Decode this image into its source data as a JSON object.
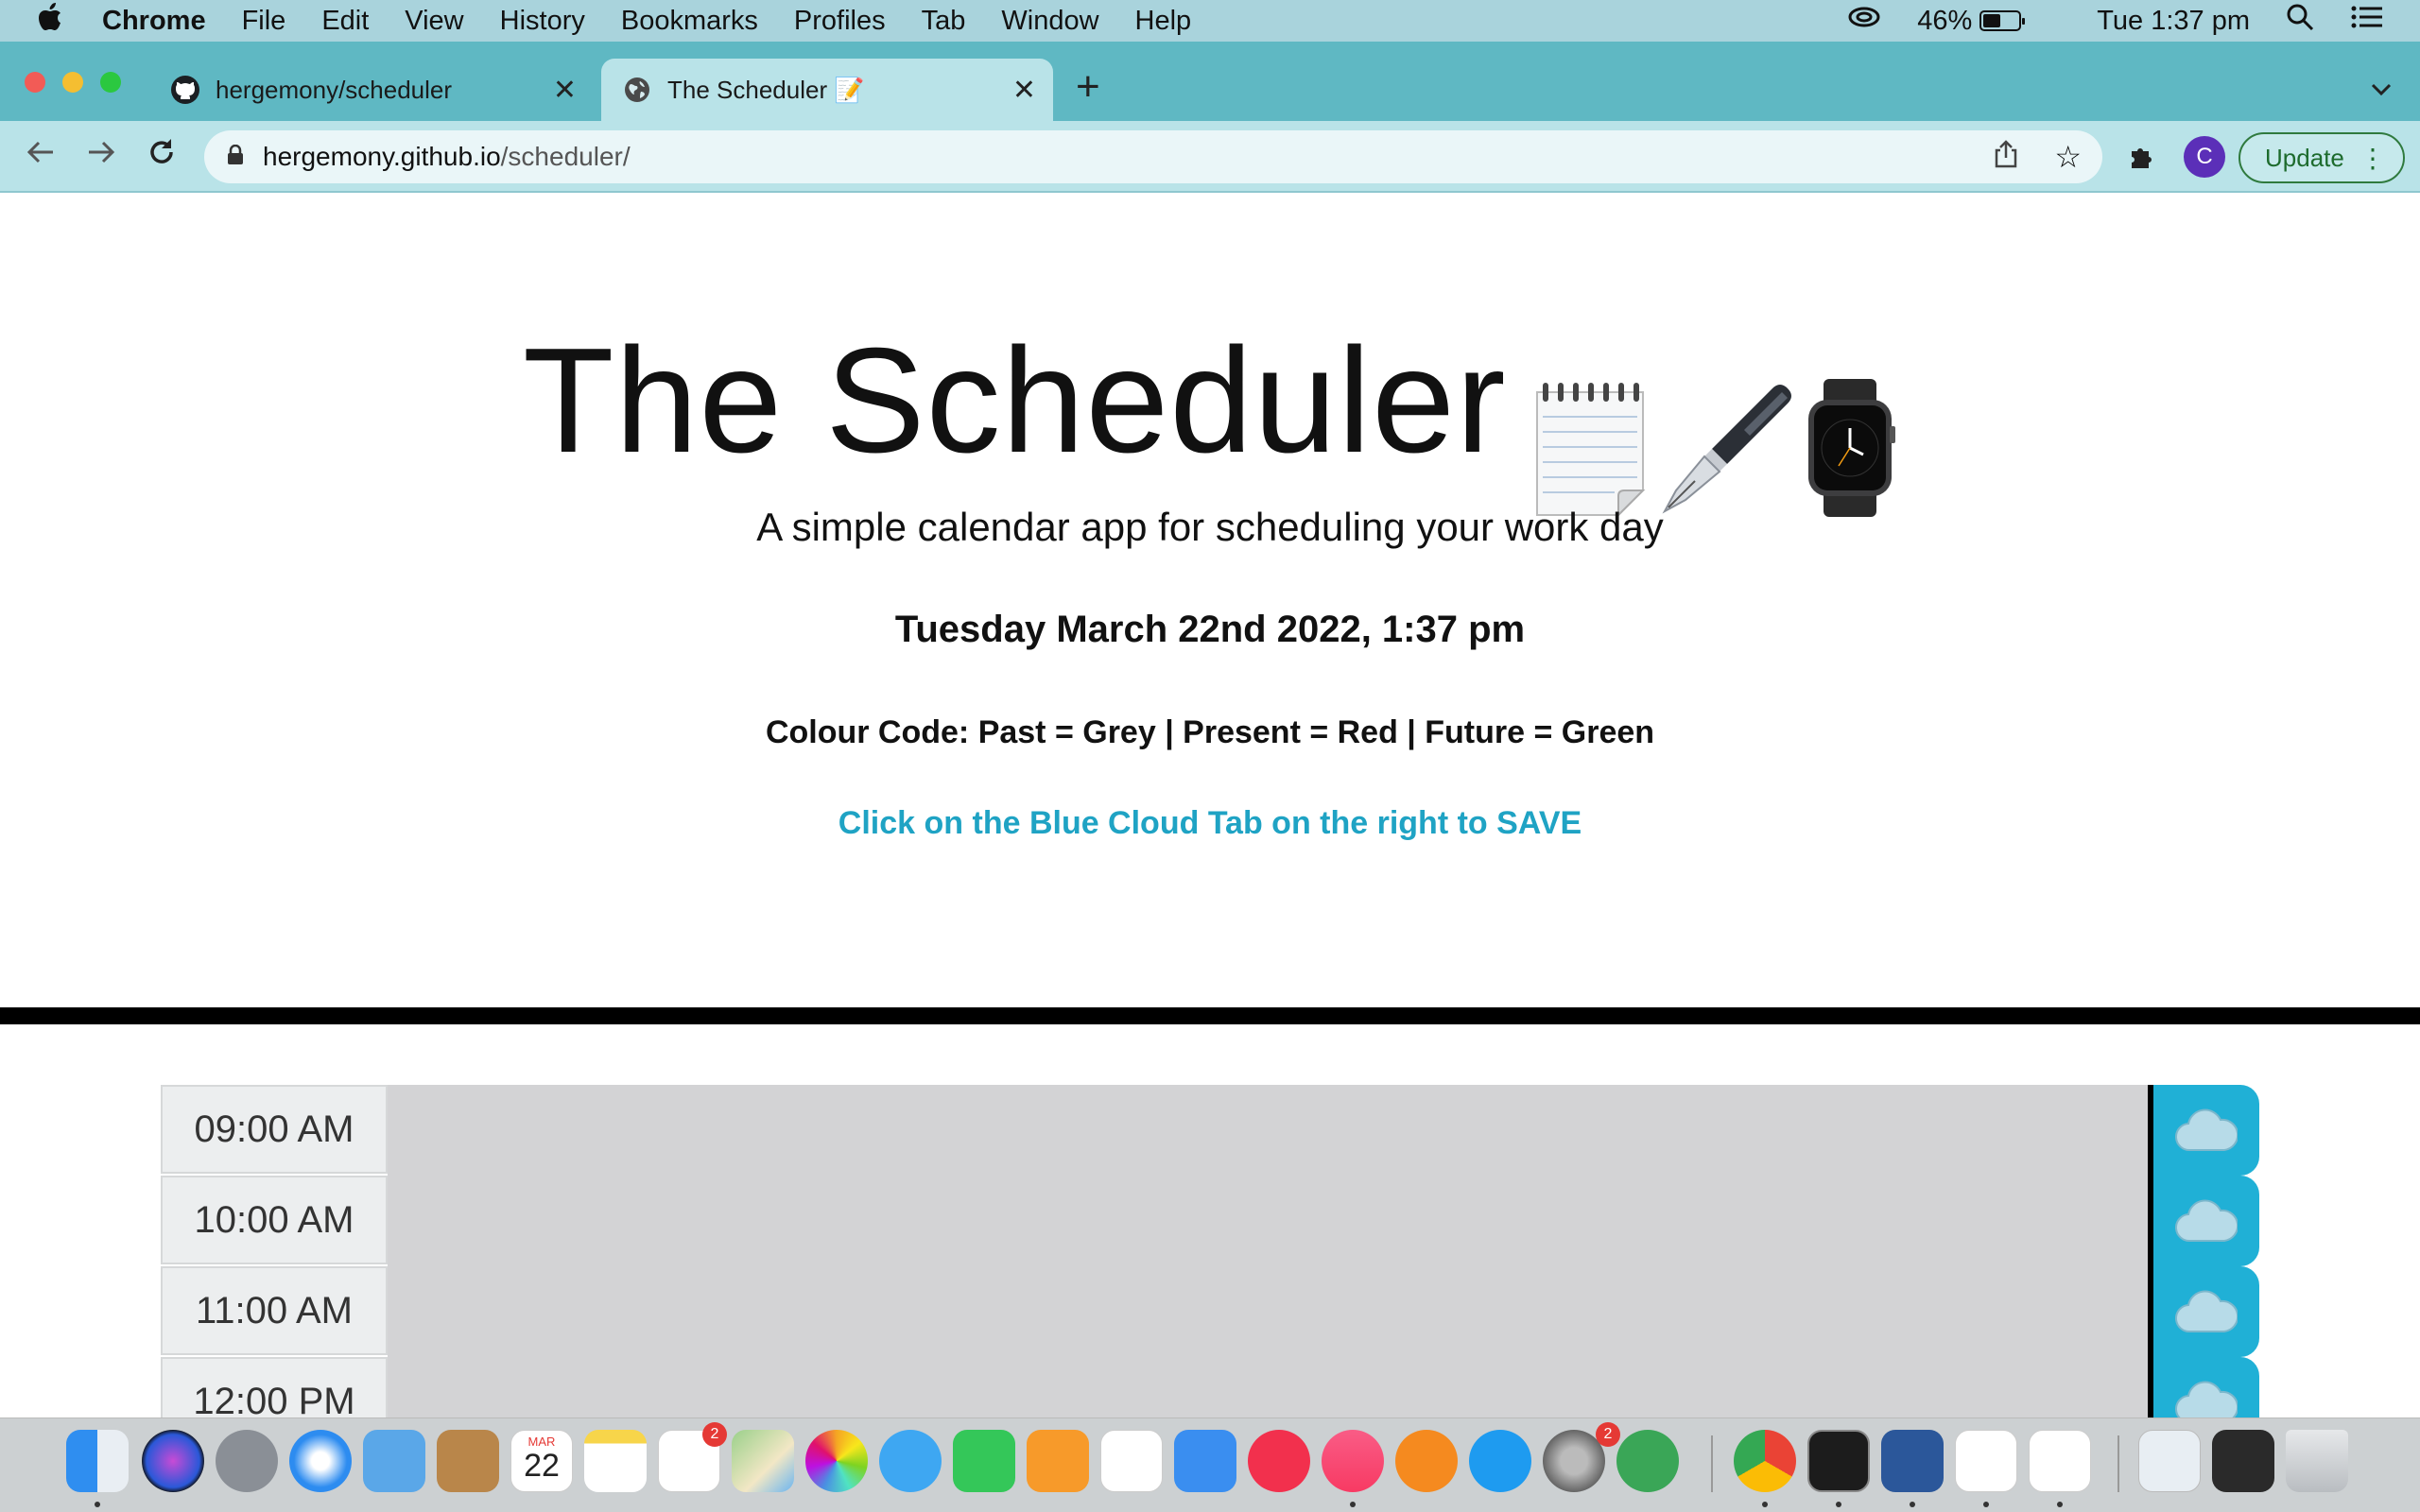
{
  "menubar": {
    "app": "Chrome",
    "items": [
      "File",
      "Edit",
      "View",
      "History",
      "Bookmarks",
      "Profiles",
      "Tab",
      "Window",
      "Help"
    ],
    "battery": "46%",
    "clock": "Tue 1:37 pm"
  },
  "tabs": [
    {
      "title": "hergemony/scheduler",
      "icon": "github-icon",
      "active": false
    },
    {
      "title": "The Scheduler 📝",
      "icon": "globe-icon",
      "active": true
    }
  ],
  "address": {
    "host": "hergemony.github.io",
    "path": "/scheduler/"
  },
  "toolbar": {
    "profile_initial": "C",
    "update_label": "Update"
  },
  "page": {
    "title": "The Scheduler",
    "title_emoji": "📝🖋⌚",
    "subtitle": "A simple calendar app for scheduling your work day",
    "datetime": "Tuesday March 22nd 2022, 1:37 pm",
    "colour_code": "Colour Code: Past = Grey | Present = Red | Future = Green",
    "save_hint": "Click on the Blue Cloud Tab on the right to SAVE"
  },
  "hours": [
    {
      "time": "09:00 AM",
      "status": "past",
      "text": ""
    },
    {
      "time": "10:00 AM",
      "status": "past",
      "text": ""
    },
    {
      "time": "11:00 AM",
      "status": "past",
      "text": ""
    },
    {
      "time": "12:00 PM",
      "status": "past",
      "text": ""
    }
  ],
  "colors": {
    "past": "#d3d3d5",
    "save": "#20b0d6",
    "hint": "#1fa3c4"
  },
  "dock": {
    "apps": [
      "finder",
      "siri",
      "launchpad",
      "safari",
      "mail",
      "contacts",
      "calendar",
      "notes",
      "reminders",
      "maps",
      "photos",
      "messages",
      "facetime",
      "pages",
      "numbers",
      "keynote",
      "news",
      "music",
      "books",
      "app-store",
      "system-preferences",
      "scrivener",
      "chrome",
      "terminal",
      "word",
      "vscode",
      "slack",
      "archive",
      "screen-capture",
      "trash"
    ],
    "calendar_month": "MAR",
    "calendar_day": "22",
    "reminders_badge": "2",
    "system_preferences_badge": "2"
  }
}
